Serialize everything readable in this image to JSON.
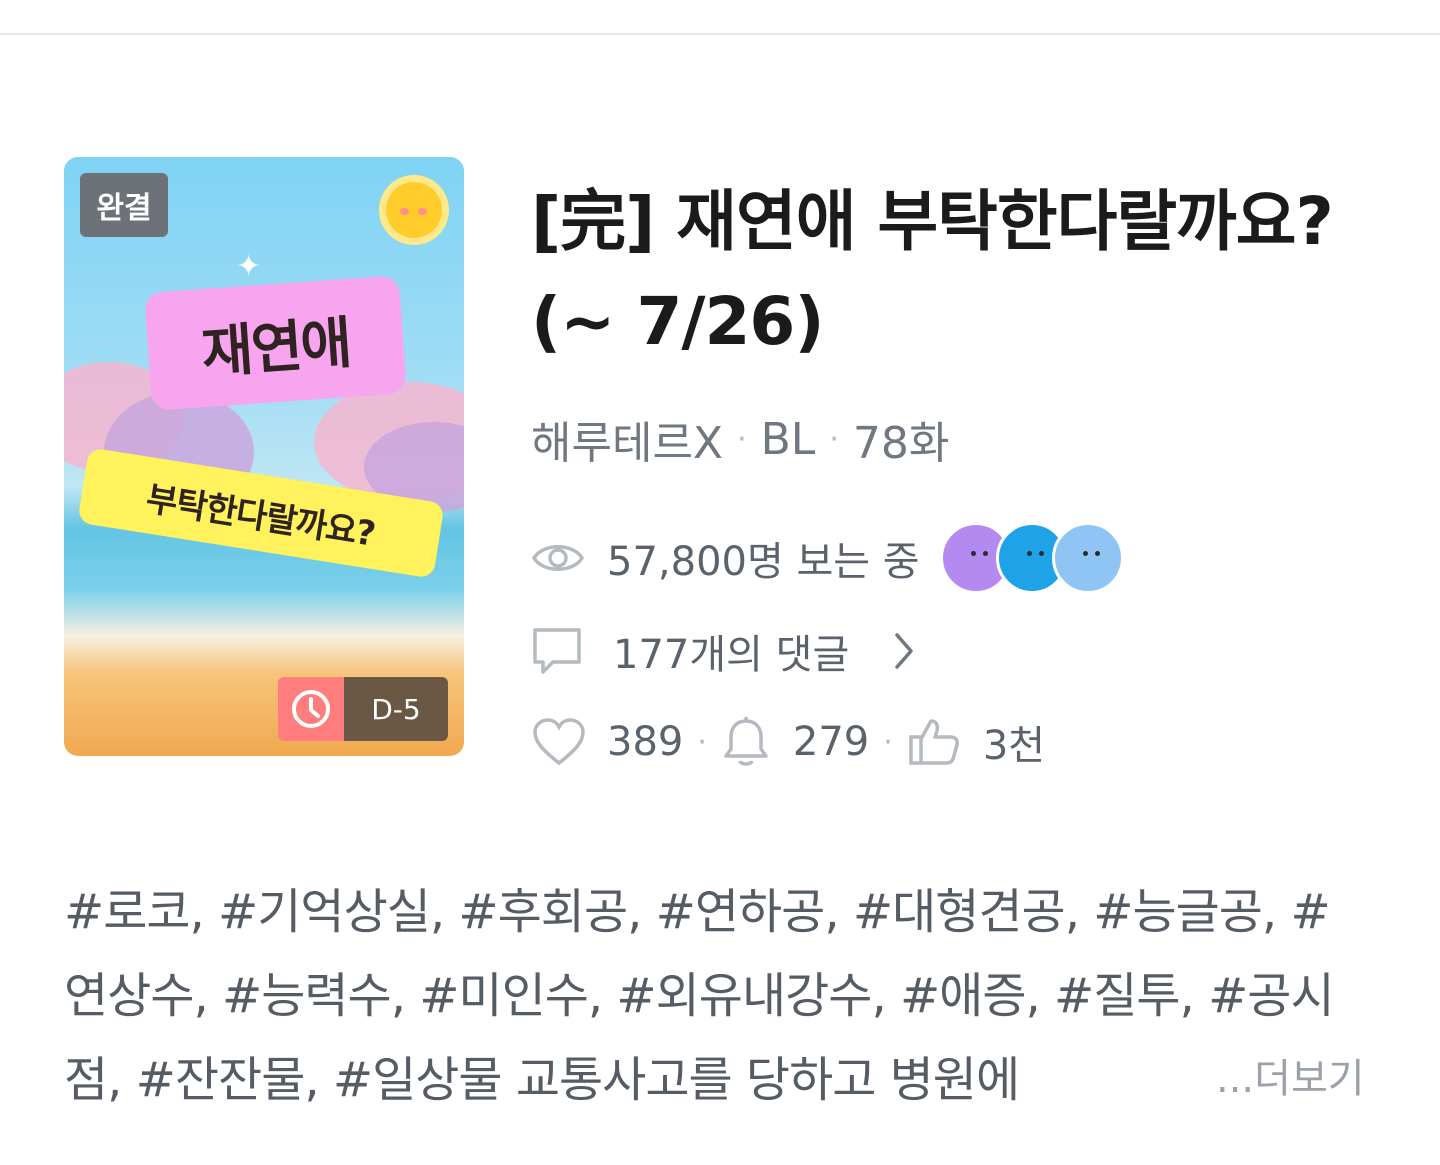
{
  "cover": {
    "badge": "완결",
    "title_text": "재연애",
    "subtitle_text": "부탁한다랄까요?",
    "dday": "D-5"
  },
  "work": {
    "title": "[完] 재연애 부탁한다랄까요? (~ 7/26)",
    "author": "해루테르X",
    "genre": "BL",
    "episodes": "78화"
  },
  "stats": {
    "viewers": "57,800명 보는 중",
    "comments": "177개의 댓글",
    "likes": "389",
    "subscribers": "279",
    "recommends": "3천"
  },
  "colors": {
    "avatar1": "#b48af0",
    "avatar2": "#1fa3e8",
    "avatar3": "#8fc5f5"
  },
  "tags": {
    "text": "#로코, #기억상실, #후회공, #연하공, #대형견공, #능글공, #연상수, #능력수, #미인수, #외유내강수, #애증, #질투, #공시점, #잔잔물, #일상물 교통사고를 당하고 병원에",
    "more_label": "...더보기"
  }
}
